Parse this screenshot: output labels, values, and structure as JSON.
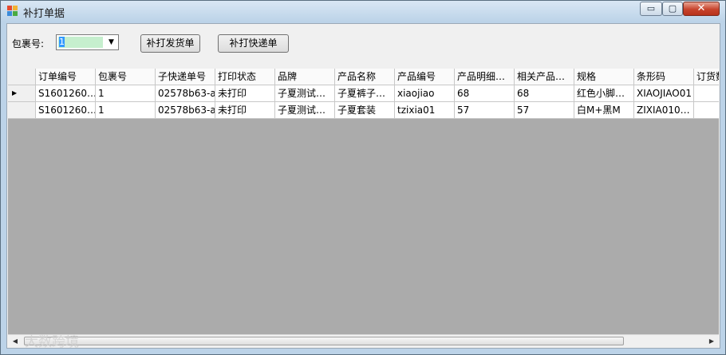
{
  "window": {
    "title": "补打单据"
  },
  "titlebar_controls": {
    "minimize": "▭",
    "maximize": "▢",
    "close": "✕"
  },
  "form": {
    "package_label": "包裹号:",
    "package_value": "1",
    "reprint_delivery": "补打发货单",
    "reprint_express": "补打快递单"
  },
  "table": {
    "columns": [
      "订单编号",
      "包裹号",
      "子快递单号",
      "打印状态",
      "品牌",
      "产品名称",
      "产品编号",
      "产品明细…",
      "相关产品…",
      "规格",
      "条形码",
      "订货数"
    ],
    "rows": [
      [
        "S1601260…",
        "1",
        "02578b63-a",
        "未打印",
        "子夏测试…",
        "子夏裤子…",
        "xiaojiao",
        "68",
        "68",
        "红色小脚…",
        "XIAOJIAO01",
        ""
      ],
      [
        "S1601260…",
        "1",
        "02578b63-a",
        "未打印",
        "子夏测试…",
        "子夏套装",
        "tzixia01",
        "57",
        "57",
        "白M+黑M",
        "ZIXIA010…",
        ""
      ]
    ],
    "current_row_marker": "▶"
  },
  "scrollbar": {
    "left_arrow": "◀",
    "right_arrow": "▶"
  },
  "watermark": "大数跨境"
}
